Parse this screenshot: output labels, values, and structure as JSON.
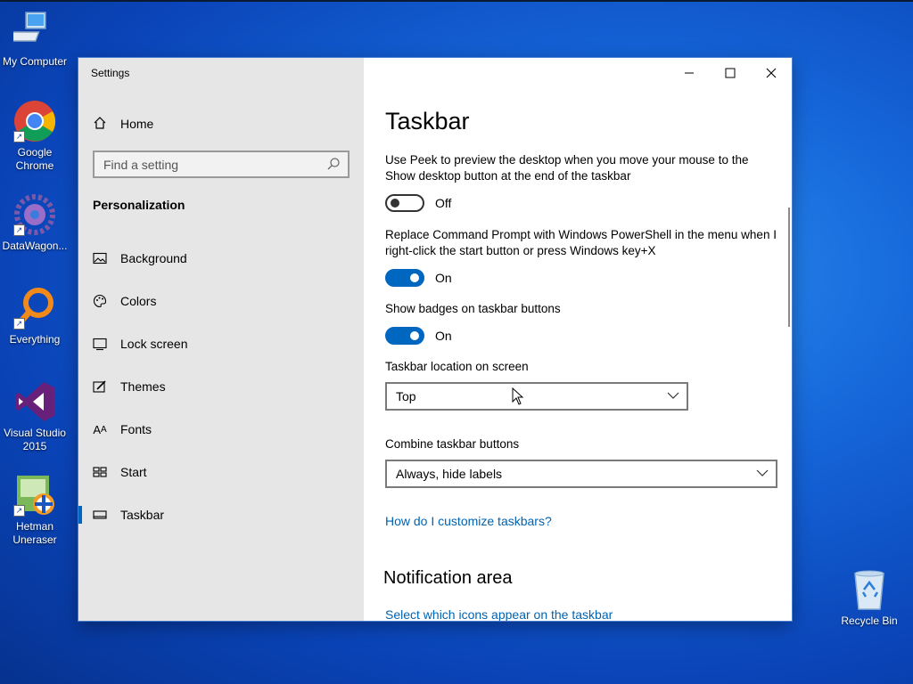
{
  "desktop": {
    "icons": [
      {
        "label": "My Computer",
        "icon": "computer-icon"
      },
      {
        "label": "Google Chrome",
        "icon": "chrome-icon"
      },
      {
        "label": "DataWagon...",
        "icon": "datawagon-icon"
      },
      {
        "label": "Everything",
        "icon": "everything-search-icon"
      },
      {
        "label": "Visual Studio 2015",
        "icon": "visual-studio-icon"
      },
      {
        "label": "Hetman Uneraser",
        "icon": "hetman-uneraser-icon"
      },
      {
        "label": "Recycle Bin",
        "icon": "recycle-bin-icon"
      }
    ]
  },
  "window": {
    "title": "Settings",
    "controls": {
      "minimize": "—",
      "maximize": "☐",
      "close": "✕"
    }
  },
  "sidebar": {
    "home_label": "Home",
    "search_placeholder": "Find a setting",
    "section": "Personalization",
    "items": [
      {
        "label": "Background",
        "icon": "picture-icon"
      },
      {
        "label": "Colors",
        "icon": "palette-icon"
      },
      {
        "label": "Lock screen",
        "icon": "lock-screen-icon"
      },
      {
        "label": "Themes",
        "icon": "themes-brush-icon"
      },
      {
        "label": "Fonts",
        "icon": "fonts-icon"
      },
      {
        "label": "Start",
        "icon": "start-grid-icon"
      },
      {
        "label": "Taskbar",
        "icon": "taskbar-icon",
        "active": true
      }
    ]
  },
  "main": {
    "title": "Taskbar",
    "settings": {
      "peek": {
        "desc": "Use Peek to preview the desktop when you move your mouse to the Show desktop button at the end of the taskbar",
        "state": "Off"
      },
      "powershell": {
        "desc": "Replace Command Prompt with Windows PowerShell in the menu when I right-click the start button or press Windows key+X",
        "state": "On"
      },
      "badges": {
        "desc": "Show badges on taskbar buttons",
        "state": "On"
      }
    },
    "location": {
      "label": "Taskbar location on screen",
      "value": "Top"
    },
    "combine": {
      "label": "Combine taskbar buttons",
      "value": "Always, hide labels"
    },
    "help_link": "How do I customize taskbars?",
    "notification": {
      "title": "Notification area",
      "link": "Select which icons appear on the taskbar"
    }
  },
  "colors": {
    "accent": "#0067c0",
    "link": "#0063b1",
    "sidebar_bg": "#e6e6e6"
  }
}
